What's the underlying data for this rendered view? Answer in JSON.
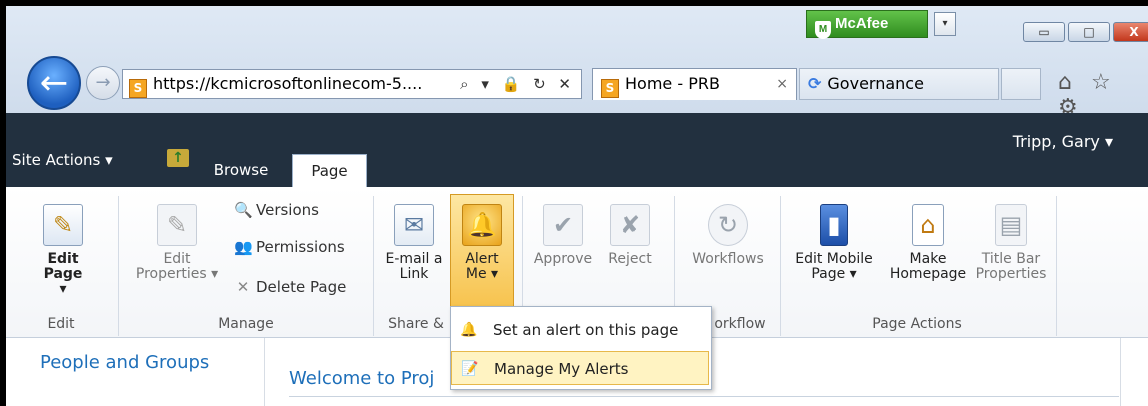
{
  "browser": {
    "mcafee_label": "McAfee",
    "mcafee_dropdown": "▾",
    "window_buttons": {
      "minimize": "▭",
      "maximize": "□",
      "close": "X"
    },
    "back_icon": "←",
    "forward_icon": "→",
    "address": "https://kcmicrosoftonlinecom-5....",
    "address_icons": "⌕ ▾ 🔒 ↻ ✕",
    "tabs": [
      {
        "label": "Home - PRB",
        "close": "×",
        "active": true
      },
      {
        "label": "Governance",
        "active": false
      }
    ],
    "toolbar_icons": "⌂ ☆ ⚙"
  },
  "suitebar": {
    "site_actions": "Site Actions ▾",
    "tabs": {
      "browse": "Browse",
      "page": "Page"
    },
    "user": "Tripp, Gary ▾"
  },
  "ribbon": {
    "groups": {
      "edit": "Edit",
      "manage": "Manage",
      "share": "Share &",
      "workflow": "orkflow",
      "page_actions": "Page Actions"
    },
    "buttons": {
      "edit_page": "Edit Page",
      "edit_page_arrow": "▾",
      "edit_properties_1": "Edit",
      "edit_properties_2": "Properties ▾",
      "versions": "Versions",
      "permissions": "Permissions",
      "delete_page": "Delete Page",
      "email_link_1": "E-mail a",
      "email_link_2": "Link",
      "alert_me_1": "Alert",
      "alert_me_2": "Me ▾",
      "approve": "Approve",
      "reject": "Reject",
      "workflows": "Workflows",
      "edit_mobile_1": "Edit Mobile",
      "edit_mobile_2": "Page ▾",
      "make_homepage_1": "Make",
      "make_homepage_2": "Homepage",
      "title_bar_1": "Title Bar",
      "title_bar_2": "Properties"
    },
    "alert_menu": [
      {
        "label": "Set an alert on this page"
      },
      {
        "label": "Manage My Alerts",
        "highlighted": true
      }
    ]
  },
  "content": {
    "left_nav": "People and Groups",
    "welcome": "Welcome to Proj"
  },
  "colors": {
    "suitebar": "#22303f",
    "link": "#1e6fb9",
    "alert_highlight": "#f7c34e"
  }
}
